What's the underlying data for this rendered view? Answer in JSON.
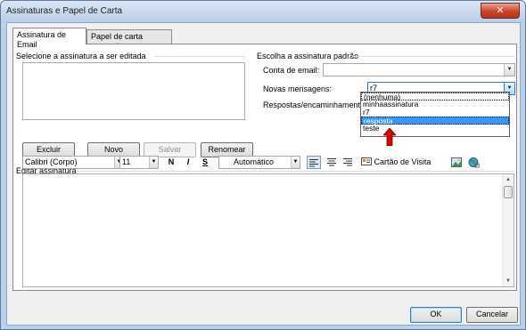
{
  "window": {
    "title": "Assinaturas e Papel de Carta",
    "close_glyph": "✕"
  },
  "tabs": [
    {
      "label": "Assinatura de Email",
      "active": true
    },
    {
      "label": "Papel de carta pessoal",
      "active": false
    }
  ],
  "left_group": {
    "label": "Selecione a assinatura a ser editada",
    "buttons": {
      "delete": "Excluir",
      "new": "Novo",
      "save": "Salvar",
      "rename": "Renomear"
    }
  },
  "right_group": {
    "label": "Escolha a assinatura padrão",
    "email_account_label": "Conta de email:",
    "email_account_value": "",
    "new_messages_label": "Novas mensagens:",
    "new_messages_value": "r7",
    "replies_label": "Respostas/encaminhamentos:",
    "dropdown_options": [
      "(nenhuma)",
      "minhaassinatura",
      "r7",
      "resposta",
      "teste"
    ],
    "dropdown_selected": "resposta"
  },
  "edit_group": {
    "label": "Editar assinatura",
    "font_name": "Calibri (Corpo)",
    "font_size": "11",
    "bold": "N",
    "italic": "I",
    "underline": "S",
    "color": "Automático",
    "business_card": "Cartão de Visita",
    "editor_text": ""
  },
  "footer": {
    "ok": "OK",
    "cancel": "Cancelar"
  },
  "colors": {
    "selection": "#3399ff",
    "arrow_red": "#d40000",
    "frame_blue": "#bcd0e8"
  }
}
